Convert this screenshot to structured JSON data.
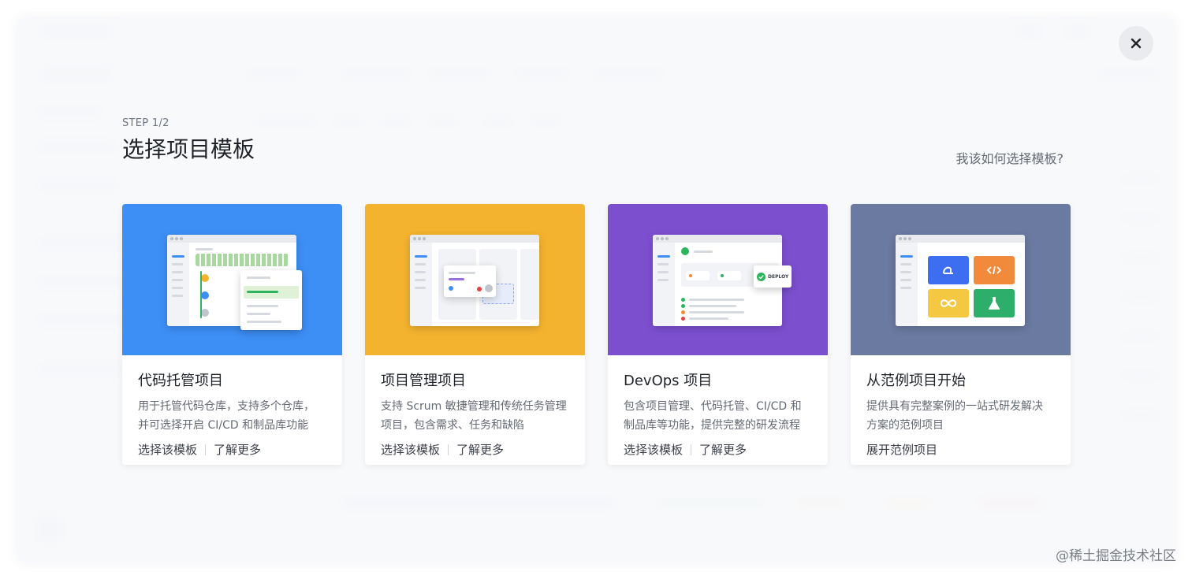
{
  "modal": {
    "step": "STEP 1/2",
    "title": "选择项目模板",
    "help_link": "我该如何选择模板?"
  },
  "templates": [
    {
      "name": "代码托管项目",
      "desc_line1": "用于托管代码仓库，支持多个仓库，",
      "desc_line2": "并可选择开启 CI/CD 和制品库功能",
      "action_select": "选择该模板",
      "action_learn": "了解更多",
      "color": "#3d8ef5"
    },
    {
      "name": "项目管理项目",
      "desc_line1": "支持 Scrum 敏捷管理和传统任务管理",
      "desc_line2": "项目，包含需求、任务和缺陷",
      "action_select": "选择该模板",
      "action_learn": "了解更多",
      "color": "#f4b32f"
    },
    {
      "name": "DevOps 项目",
      "desc_line1": "包含项目管理、代码托管、CI/CD 和",
      "desc_line2": "制品库等功能，提供完整的研发流程",
      "action_select": "选择该模板",
      "action_learn": "了解更多",
      "color": "#7c4fcf",
      "deploy_label": "DEPLOY"
    },
    {
      "name": "从范例项目开始",
      "desc_line1": "提供具有完整案例的一站式研发解决",
      "desc_line2": "方案的范例项目",
      "action_expand": "展开范例项目",
      "color": "#6a7aa0"
    }
  ],
  "watermark": "@稀土掘金技术社区",
  "icons": {
    "close": "close-icon",
    "deploy_check": "check-circle-icon",
    "tile_icons": [
      "ci-icon",
      "code-icon",
      "infinity-icon",
      "flask-icon"
    ]
  }
}
